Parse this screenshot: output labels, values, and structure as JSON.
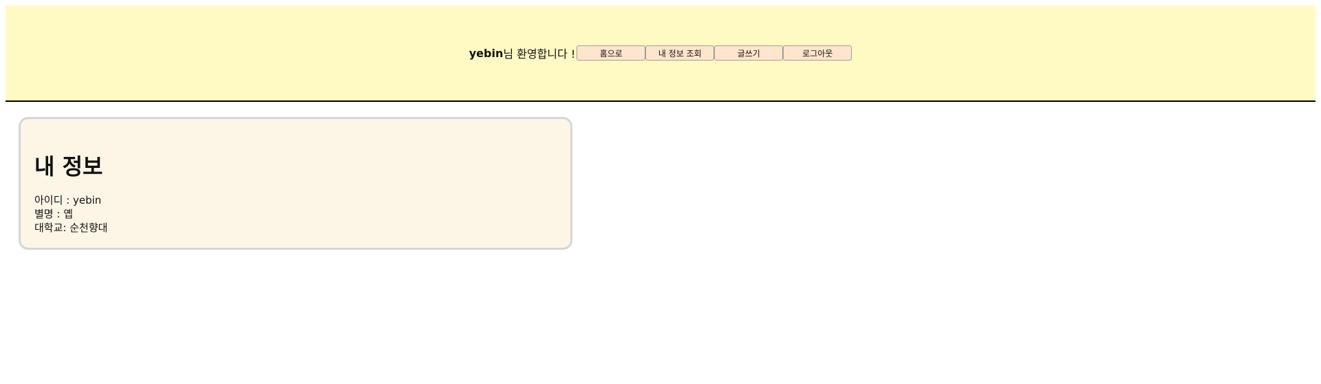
{
  "header": {
    "username": "yebin",
    "greeting_suffix": "님 환영합니다 !",
    "buttons": [
      {
        "label": "홈으로"
      },
      {
        "label": "내 정보 조회"
      },
      {
        "label": "글쓰기"
      },
      {
        "label": "로그아웃"
      }
    ]
  },
  "profile": {
    "title": "내 정보",
    "id_line": "아이디 : yebin",
    "nickname_line": "별명 : 옙",
    "university_line": "대학교: 순천향대"
  },
  "colors": {
    "header_bg": "#fff9c4",
    "button_bg": "#ffe5cc",
    "card_bg": "#fdf5e6",
    "card_border": "#d6d6d6"
  }
}
